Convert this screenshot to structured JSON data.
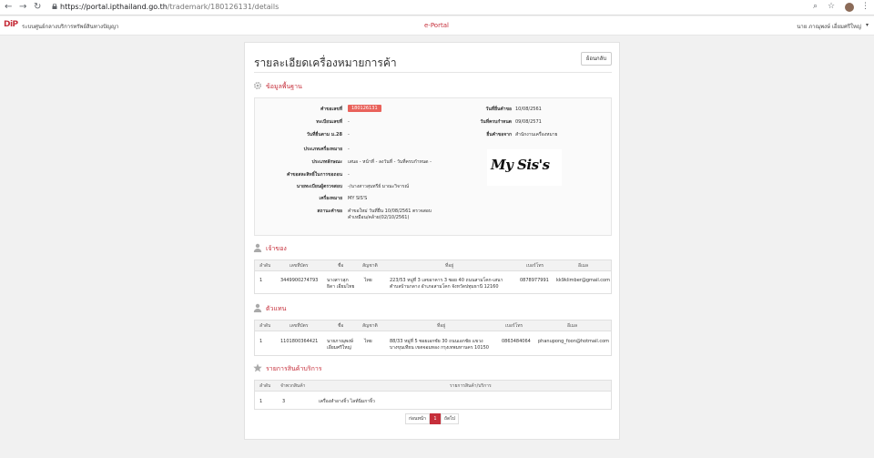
{
  "browser": {
    "url_host": "https://portal.ipthailand.go.th",
    "url_path": "/trademark/180126131/details"
  },
  "header": {
    "logo": "DiP",
    "org_name": "ระบบศูนย์กลางบริการทรัพย์สินทางปัญญา",
    "portal": "e-Portal",
    "user": "นาย ภาณุพงษ์ เอี่ยมศรีใหญ่"
  },
  "page": {
    "title": "รายละเอียดเครื่องหมายการค้า",
    "back_label": "ย้อนกลับ"
  },
  "basic": {
    "title": "ข้อมูลพื้นฐาน",
    "fields": {
      "request_no_label": "คำขอเลขที่",
      "request_no": "180126131",
      "reg_no_label": "ทะเบียนเลขที่",
      "reg_no": "-",
      "sec28_label": "วันที่ยื่นตาม ม.28",
      "sec28": "-",
      "mark_type_label": "ประเภทเครื่องหมาย",
      "mark_type": "-",
      "mark_char_label": "ประเภทลักษณะ",
      "mark_char": "เสนอ - หน้าที่ - ลงวันที่ - วันที่ครบกำหนด -",
      "disclaim_label": "คำขอสละสิทธิ์ในการขอถอน",
      "disclaim": "-",
      "agent_label": "นายทะเบียนผู้ตรวจสอบ",
      "agent": "-/นางสาวสุนทรีย์ มาณะวิจารณ์",
      "mark_name_label": "เครื่องหมาย",
      "mark_name": "MY SIS'S",
      "status_label": "สถานะคำขอ",
      "status_line1": "คำขอใหม่ วันที่ยื่น 10/08/2561 ตรวจสอบ",
      "status_line2": "คำเหมือน/คล้าย(02/10/2561)",
      "filing_date_label": "วันที่ยื่นคำขอ",
      "filing_date": "10/08/2561",
      "expire_date_label": "วันที่ครบกำหนด",
      "expire_date": "09/08/2571",
      "source_label": "ยื่นคำขอจาก",
      "source": "สำนักงานเครื่องหมาย"
    },
    "mark_image_text": "My Sis's"
  },
  "owner": {
    "title": "เจ้าของ",
    "headers": [
      "ลำดับ",
      "เลขที่บัตร",
      "ชื่อ",
      "สัญชาติ",
      "ที่อยู่",
      "เบอร์โทร",
      "อีเมล"
    ],
    "rows": [
      {
        "no": "1",
        "id": "3449900274793",
        "name1": "นางสาวสุภ",
        "name2": "ธิดา เอี่ยมไทย",
        "nationality": "ไทย",
        "addr1": "223/53 หมู่ที่ 3 เลขอาคาร 3 ซอย 40 ถนนสามโคก-เสนา",
        "addr2": "ตำบลบ้านกลาง อำเภอสามโคก จังหวัดปทุมธานี 12160",
        "phone": "0878977991",
        "email": "kk9klimber@gmail.com"
      }
    ]
  },
  "agent": {
    "title": "ตัวแทน",
    "headers": [
      "ลำดับ",
      "เลขที่บัตร",
      "ชื่อ",
      "สัญชาติ",
      "ที่อยู่",
      "เบอร์โทร",
      "อีเมล"
    ],
    "rows": [
      {
        "no": "1",
        "id": "1101800364421",
        "name1": "นายภาณุพงษ์",
        "name2": "เอี่ยมศรีใหญ่",
        "nationality": "ไทย",
        "addr1": "88/33 หมู่ที่ 5 ซอยเอกชัย 30 ถนนเอกชัย แขวง",
        "addr2": "บางขุนเทียน เขตจอมทอง กรุงเทพมหานคร 10150",
        "phone": "0863484064",
        "email": "phanupong_foon@hotmail.com"
      }
    ]
  },
  "goods": {
    "title": "รายการสินค้าบริการ",
    "headers": [
      "ลำดับ",
      "จำพวกสินค้า",
      "รายการสินค้า/บริการ"
    ],
    "rows": [
      {
        "no": "1",
        "class": "3",
        "items": "เครื่องสำอางจิ้ว ไลท์นิ่มกาจิ้ว"
      }
    ]
  },
  "pagination": {
    "prev": "ก่อนหน้า",
    "current": "1",
    "next": "ถัดไป"
  }
}
